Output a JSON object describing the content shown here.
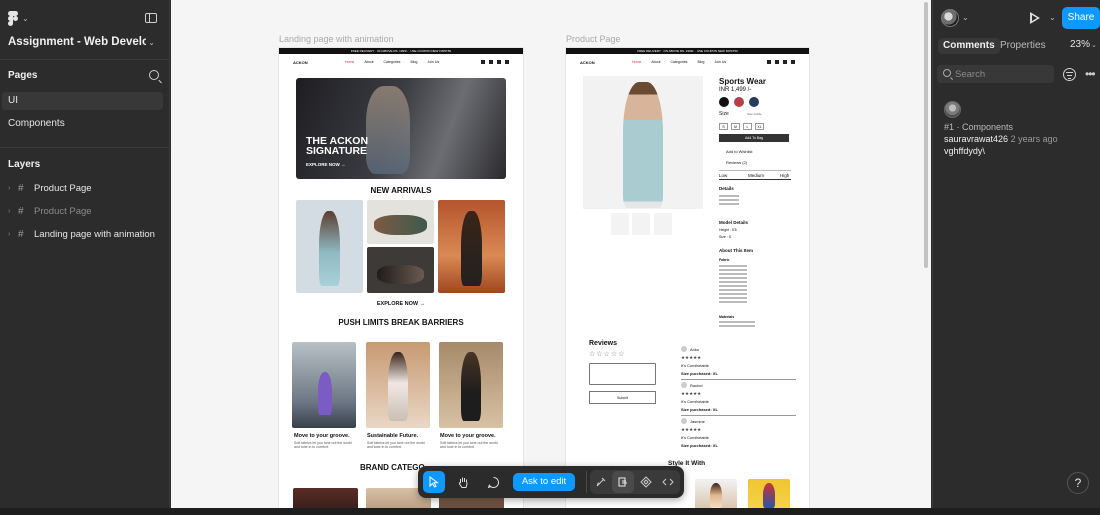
{
  "left_panel": {
    "file_title": "Assignment - Web Develop...",
    "pages_label": "Pages",
    "pages": [
      {
        "label": "UI",
        "active": true
      },
      {
        "label": "Components",
        "active": false
      }
    ],
    "layers_label": "Layers",
    "layers": [
      {
        "label": "Product Page",
        "dim": false
      },
      {
        "label": "Product Page",
        "dim": true
      },
      {
        "label": "Landing page with animation",
        "dim": false
      }
    ],
    "icons": [
      "figma-menu-icon",
      "panel-toggle-icon",
      "search-icon",
      "frame-hash-icon"
    ]
  },
  "canvas": {
    "background": "#f5f5f5",
    "frames": [
      {
        "label": "Landing page with animation",
        "topstrip": "FREE DELIVERY · ON ABOVE RS. 1999/- · USE COUPON NEW FIRST50",
        "brand": "ACKON",
        "nav_links": [
          "Home",
          "About",
          "Categories",
          "Blog",
          "Join Us"
        ],
        "hero_title": "THE ACKON SIGNATURE",
        "hero_cta": "EXPLORE NOW →",
        "new_arrivals_title": "NEW ARRIVALS",
        "explore_label": "EXPLORE NOW →",
        "push_title": "PUSH LIMITS BREAK BARRIERS",
        "cards": [
          {
            "title": "Move to your groove.",
            "text": "Soft fabrics let you tone out the world and tune in to comfort."
          },
          {
            "title": "Sustainable Future.",
            "text": "Soft fabrics let you tone out the world and tune in to comfort."
          },
          {
            "title": "Move to your groove.",
            "text": "Soft fabrics let you tone out the world and tune in to comfort."
          }
        ],
        "brand_categ_title": "BRAND CATEGO"
      },
      {
        "label": "Product Page",
        "topstrip": "FREE DELIVERY · ON ABOVE RS. 1999/- · USE COUPON NEW FIRST50",
        "brand": "ACKON",
        "nav_links": [
          "Home",
          "About",
          "Categories",
          "Blog",
          "Join Us"
        ],
        "product_title": "Sports Wear",
        "price": "INR 1,499 /-",
        "swatch_colors": [
          "#111111",
          "#b5404a",
          "#2a3a5c"
        ],
        "size_label": "Size",
        "size_guide": "Size Guide",
        "sizes": [
          "S",
          "M",
          "L",
          "XL"
        ],
        "add_to_bag": "Add To Bag",
        "wishlist": "Add to Wishlist",
        "reviews_count": "Reviews (2)",
        "levels": [
          "Low",
          "Medium",
          "High"
        ],
        "details": "Details",
        "model_details": "Model Details",
        "height": "Height : 5'8",
        "size_small": "Size : S",
        "about": "About This Item",
        "fabric": "Fabric",
        "material": "Materials",
        "reviews_title": "Reviews",
        "stars": "☆☆☆☆☆",
        "submit": "Submit",
        "reviews": [
          {
            "name": "Anku",
            "stars": "★★★★★",
            "text": "It's Comfortable",
            "size": "Size purchased: XL"
          },
          {
            "name": "Rachel",
            "stars": "★★★★★",
            "text": "It's Comfortable",
            "size": "Size purchased: XL"
          },
          {
            "name": "Jasmine",
            "stars": "★★★★★",
            "text": "It's Comfortable",
            "size": "Size purchased: XL"
          }
        ],
        "style_title": "Style It With"
      }
    ]
  },
  "toolbar": {
    "ask_to_edit": "Ask to edit",
    "tools": [
      "move-tool-icon",
      "hand-tool-icon",
      "comment-tool-icon"
    ],
    "modes": [
      "design-mode-icon",
      "dev-mode-icon",
      "components-icon",
      "code-icon"
    ]
  },
  "right_panel": {
    "share": "Share",
    "tabs": [
      "Comments",
      "Properties"
    ],
    "zoom": "23%",
    "search_placeholder": "Search",
    "comment": {
      "meta": "#1 · Components",
      "user": "sauravrawat426",
      "time": "2 years ago",
      "text": "vghffdydy\\"
    },
    "help": "?"
  }
}
